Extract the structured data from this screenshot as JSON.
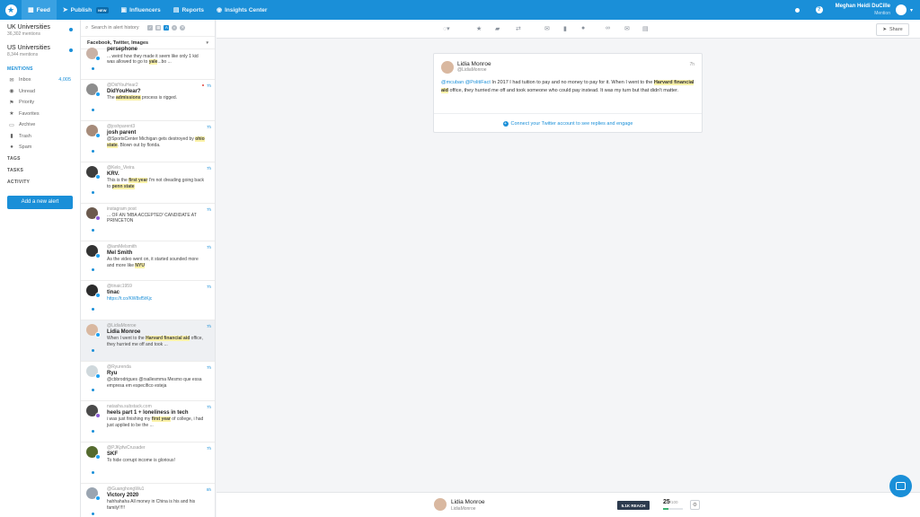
{
  "nav": {
    "items": [
      {
        "label": "Feed",
        "icon": "feed-icon"
      },
      {
        "label": "Publish",
        "badge": "NEW",
        "icon": "publish-icon"
      },
      {
        "label": "Influencers",
        "icon": "influencers-icon"
      },
      {
        "label": "Reports",
        "icon": "reports-icon"
      },
      {
        "label": "Insights Center",
        "icon": "insights-icon"
      }
    ],
    "user_name": "Meghan Heidi DuCille",
    "user_company": "Mention",
    "accent": "#1a8fd8"
  },
  "sidebar": {
    "alerts": [
      {
        "name": "UK Universities",
        "count": "36,302 mentions"
      },
      {
        "name": "US Universities",
        "count": "8,344 mentions"
      }
    ],
    "mentions_title": "MENTIONS",
    "menu": [
      {
        "label": "Inbox",
        "count": "4,005",
        "icon": "inbox-icon"
      },
      {
        "label": "Unread",
        "icon": "eye-icon"
      },
      {
        "label": "Priority",
        "icon": "priority-icon"
      },
      {
        "label": "Favorites",
        "icon": "star-icon"
      },
      {
        "label": "Archive",
        "icon": "archive-icon"
      },
      {
        "label": "Trash",
        "icon": "trash-icon"
      },
      {
        "label": "Spam",
        "icon": "spam-icon"
      }
    ],
    "sections": [
      "TAGS",
      "TASKS",
      "ACTIVITY"
    ],
    "add_alert": "Add a new alert"
  },
  "list": {
    "search_placeholder": "Search in alert history",
    "sources": "Facebook, Twitter, Images",
    "mentions": [
      {
        "handle": "",
        "name": "persephone",
        "segments": [
          {
            "t": "... weird how they made it seem like only 1 kid was allowed to go to "
          },
          {
            "t": "yale",
            "h": true
          },
          {
            "t": "...bo ..."
          }
        ],
        "time": "",
        "source": "twitter"
      },
      {
        "handle": "@DidYouHear2",
        "name": "DidYouHear?",
        "segments": [
          {
            "t": "The "
          },
          {
            "t": "admissions",
            "h": true
          },
          {
            "t": " process is rigged."
          }
        ],
        "time": "7h",
        "source": "twitter"
      },
      {
        "handle": "@joshparent3",
        "name": "josh parent",
        "segments": [
          {
            "t": "@SportsCenter Michigan gets destroyed by "
          },
          {
            "t": "ohio state",
            "h": true
          },
          {
            "t": ". Blown out by florida."
          }
        ],
        "time": "7h",
        "source": "twitter"
      },
      {
        "handle": "@Kelo_Vieira",
        "name": "KRV.",
        "segments": [
          {
            "t": "This is the "
          },
          {
            "t": "first year",
            "h": true
          },
          {
            "t": " I'm not dreading going back to "
          },
          {
            "t": "penn state",
            "h": true
          }
        ],
        "time": "7h",
        "source": "twitter"
      },
      {
        "handle": "instagram post",
        "name": "",
        "segments": [
          {
            "t": "... OF AN 'MBA ACCEPTED' CANDIDATE AT PRINCETON"
          }
        ],
        "time": "7h",
        "source": "instagram"
      },
      {
        "handle": "@iamMelsmith",
        "name": "Mel Smith",
        "segments": [
          {
            "t": "As the video went on, it started sounded more and more like "
          },
          {
            "t": "NYU",
            "h": true
          }
        ],
        "time": "7h",
        "source": "twitter"
      },
      {
        "handle": "@tinaic1959",
        "name": "tinac",
        "segments": [
          {
            "t": "https://t.co/KW8sf5tKjc",
            "l": true
          }
        ],
        "time": "7h",
        "source": "twitter"
      },
      {
        "handle": "@LidiaMonroe",
        "name": "Lidia Monroe",
        "segments": [
          {
            "t": "When I went to the "
          },
          {
            "t": "Harvard financial aid",
            "h": true
          },
          {
            "t": " office, they hurried me off and took ..."
          }
        ],
        "time": "7h",
        "source": "twitter",
        "selected": true
      },
      {
        "handle": "@Ryurenda",
        "name": "Ryu",
        "segments": [
          {
            "t": "@cbbrodrigues @rsallesmma Mesmo que essa empresa em específico esteja"
          }
        ],
        "time": "7h",
        "source": "twitter"
      },
      {
        "handle": "natasha.substack.com",
        "name": "heels part 1 + loneliness in tech",
        "segments": [
          {
            "t": "i was just finishing my "
          },
          {
            "t": "first year",
            "h": true
          },
          {
            "t": " of college, i had just applied to be the ..."
          }
        ],
        "time": "7h",
        "source": "instagram"
      },
      {
        "handle": "@PJKpfwCrusader",
        "name": "SKF",
        "segments": [
          {
            "t": "To hide corrupt income is glorious!"
          }
        ],
        "time": "7h",
        "source": "twitter"
      },
      {
        "handle": "@GuanghongWu1",
        "name": "Victory 2020",
        "segments": [
          {
            "t": "hahhahaha All money in China is his and his family!!!!!"
          }
        ],
        "time": "8h",
        "source": "twitter"
      }
    ]
  },
  "detail": {
    "name": "Lidia Monroe",
    "handle": "@LidiaMonroe",
    "time": "7h",
    "mention_a": "@mcuban",
    "mention_b": "@PolitiFact",
    "text_1": " In 2017 I had tuition to pay and no money to pay for it. When I went to the ",
    "highlight": "Harvard financial aid",
    "text_2": " office, they hurried me off and took someone who could pay instead. It was my turn but that didn't matter.",
    "connect": "Connect your Twitter account to see replies and engage",
    "share": "Share"
  },
  "bottom": {
    "name": "Lidia Monroe",
    "handle": "LidiaMonroe",
    "reach": "5.1K REACH",
    "score": "25",
    "score_max": "/100",
    "score_value": 25
  }
}
